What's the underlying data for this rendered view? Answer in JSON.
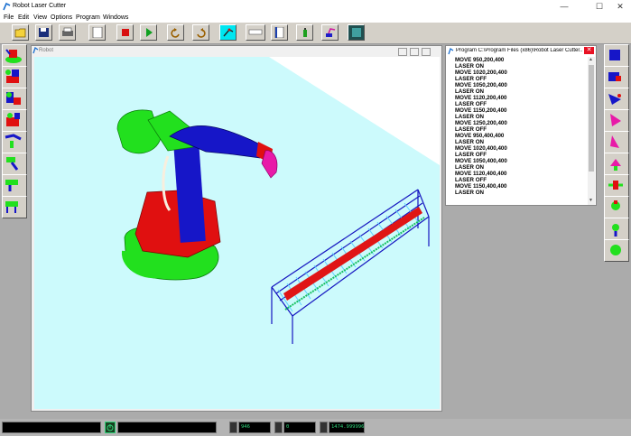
{
  "window": {
    "title": "Robot Laser Cutter",
    "controls": [
      "—",
      "☐",
      "✕"
    ]
  },
  "menu": [
    "File",
    "Edit",
    "View",
    "Options",
    "Program",
    "Windows"
  ],
  "robot_window": {
    "title": "Robot"
  },
  "program_window": {
    "title": "Program C:\\Program Files (x86)\\Robot Laser Cutter...",
    "lines": [
      "MOVE 950,200,400",
      "LASER ON",
      "MOVE 1020,200,400",
      "LASER OFF",
      "MOVE 1050,200,400",
      "LASER ON",
      "MOVE 1120,200,400",
      "LASER OFF",
      "MOVE 1150,200,400",
      "LASER ON",
      "MOVE 1250,200,400",
      "LASER OFF",
      "MOVE 950,400,400",
      "LASER ON",
      "MOVE 1020,400,400",
      "LASER OFF",
      "MOVE 1050,400,400",
      "LASER ON",
      "MOVE 1120,400,400",
      "LASER OFF",
      "MOVE 1150,400,400",
      "LASER ON"
    ]
  },
  "status": {
    "field1": "946",
    "field2": "0",
    "field3": "1474.999996"
  },
  "colors": {
    "accent": "#00e6f0",
    "viewport": "#ccfafc",
    "robot_green": "#22e01e",
    "robot_blue": "#1616c8",
    "robot_red": "#e01010",
    "status_text": "#2fd47a"
  }
}
